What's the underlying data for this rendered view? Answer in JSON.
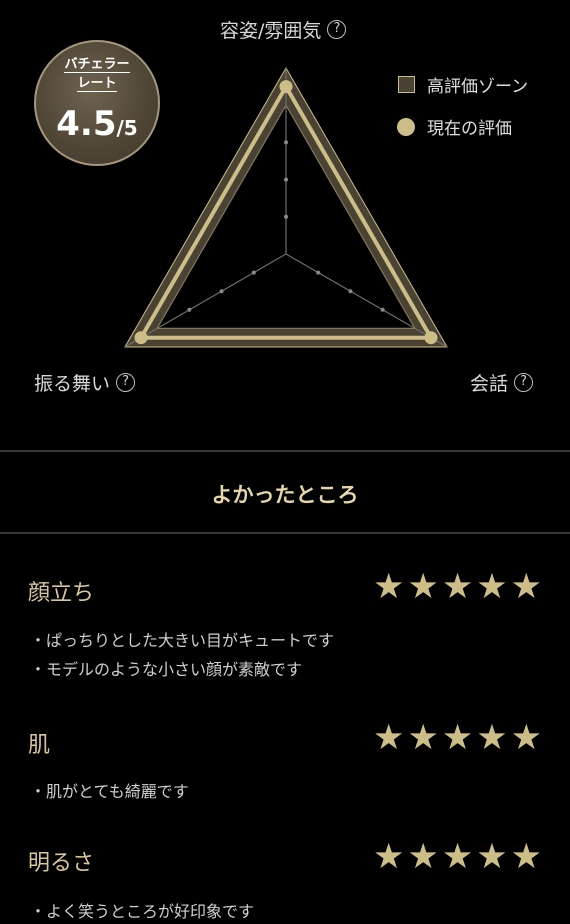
{
  "axes": {
    "top": "容姿/雰囲気",
    "left": "振る舞い",
    "right": "会話"
  },
  "help_glyph": "?",
  "badge": {
    "label_line1": "バチェラー",
    "label_line2": "レート",
    "score": "4.5",
    "max": "/5"
  },
  "legend": {
    "zone_label": "高評価ゾーン",
    "current_label": "現在の評価"
  },
  "colors": {
    "gold": "#cdbd86",
    "zone_fill": "#4a4333",
    "background": "#000000"
  },
  "radar": {
    "type": "radar",
    "axes_order": [
      "容姿/雰囲気",
      "会話",
      "振る舞い"
    ],
    "scale_max": 5,
    "high_zone": [
      4,
      5
    ],
    "current": [
      4.5,
      4.5,
      4.5
    ]
  },
  "section_title": "よかったところ",
  "categories": [
    {
      "title": "顔立ち",
      "rating": 5,
      "bullets": [
        "・ぱっちりとした大きい目がキュートです",
        "・モデルのような小さい顔が素敵です"
      ]
    },
    {
      "title": "肌",
      "rating": 5,
      "bullets": [
        "・肌がとても綺麗です"
      ]
    },
    {
      "title": "明るさ",
      "rating": 5,
      "bullets": [
        "・よく笑うところが好印象です"
      ]
    }
  ],
  "star_glyph": "★"
}
